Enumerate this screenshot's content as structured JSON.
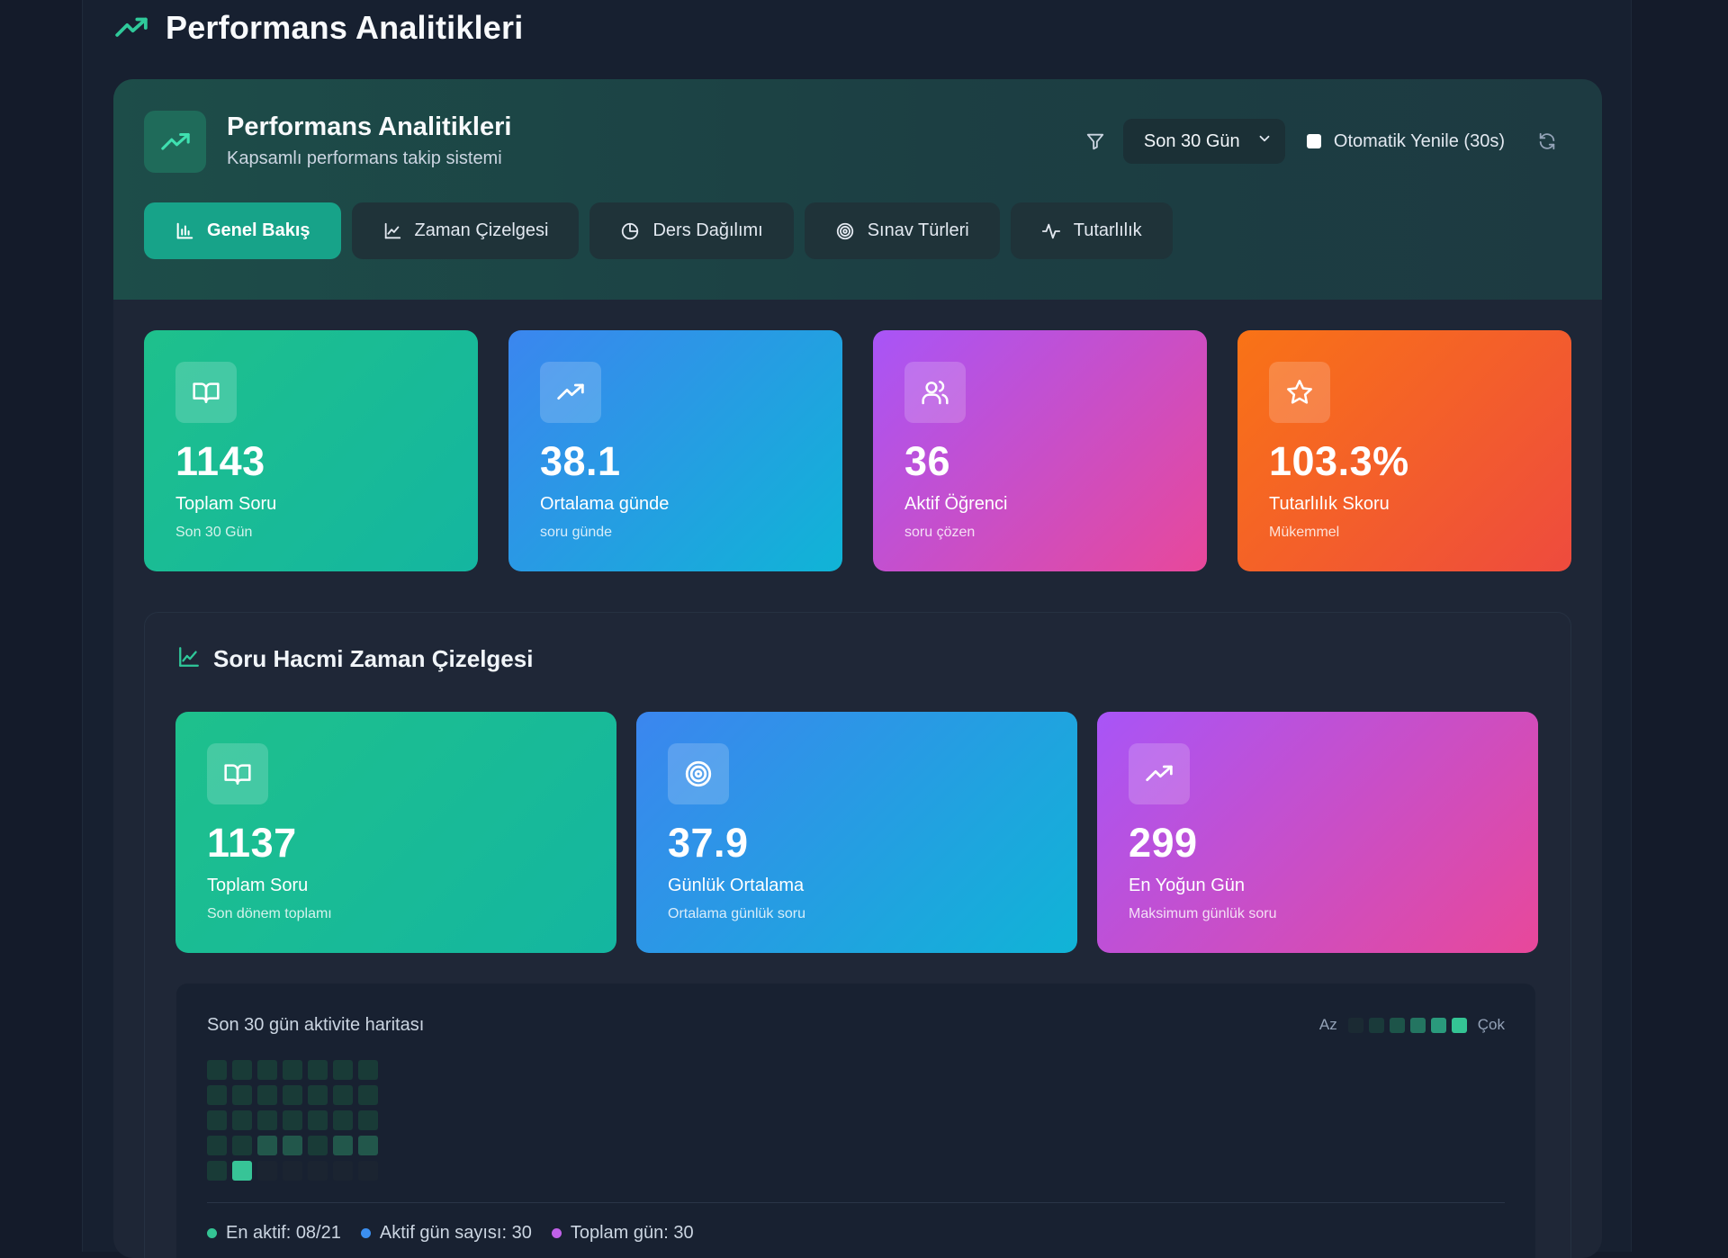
{
  "page": {
    "title": "Performans Analitikleri"
  },
  "header": {
    "title": "Performans Analitikleri",
    "subtitle": "Kapsamlı performans takip sistemi",
    "range_select": "Son 30 Gün",
    "auto_refresh_label": "Otomatik Yenile (30s)",
    "auto_refresh_checked": false
  },
  "tabs": [
    {
      "label": "Genel Bakış",
      "icon": "bar-chart-icon",
      "active": true
    },
    {
      "label": "Zaman Çizelgesi",
      "icon": "line-chart-icon",
      "active": false
    },
    {
      "label": "Ders Dağılımı",
      "icon": "pie-chart-icon",
      "active": false
    },
    {
      "label": "Sınav Türleri",
      "icon": "target-icon",
      "active": false
    },
    {
      "label": "Tutarlılık",
      "icon": "activity-icon",
      "active": false
    }
  ],
  "stats": [
    {
      "icon": "book-icon",
      "value": "1143",
      "label": "Toplam Soru",
      "sub": "Son 30 Gün"
    },
    {
      "icon": "trend-up-icon",
      "value": "38.1",
      "label": "Ortalama günde",
      "sub": "soru günde"
    },
    {
      "icon": "users-icon",
      "value": "36",
      "label": "Aktif Öğrenci",
      "sub": "soru çözen"
    },
    {
      "icon": "star-icon",
      "value": "103.3%",
      "label": "Tutarlılık Skoru",
      "sub": "Mükemmel"
    }
  ],
  "timeline": {
    "title": "Soru Hacmi Zaman Çizelgesi",
    "stats": [
      {
        "icon": "book-icon",
        "value": "1137",
        "label": "Toplam Soru",
        "sub": "Son dönem toplamı"
      },
      {
        "icon": "target-icon",
        "value": "37.9",
        "label": "Günlük Ortalama",
        "sub": "Ortalama günlük soru"
      },
      {
        "icon": "trend-up-icon",
        "value": "299",
        "label": "En Yoğun Gün",
        "sub": "Maksimum günlük soru"
      }
    ]
  },
  "heatmap": {
    "title": "Son 30 gün aktivite haritası",
    "legend_low": "Az",
    "legend_high": "Çok",
    "legend_colors": [
      "#1b2a33",
      "#1a3a3a",
      "#1d5449",
      "#247561",
      "#2a9a7c",
      "#34c494"
    ],
    "levels": [
      1,
      1,
      1,
      1,
      1,
      1,
      1,
      1,
      1,
      1,
      1,
      1,
      1,
      1,
      1,
      1,
      1,
      1,
      1,
      1,
      1,
      1,
      1,
      2,
      2,
      1,
      2,
      2,
      1,
      5,
      0,
      0,
      0,
      0,
      0
    ],
    "level_colors": [
      "#1b2431",
      "#193b37",
      "#22574b",
      "#247561",
      "#2a9a7c",
      "#37c497"
    ],
    "footer": [
      {
        "text": "En aktif: 08/21",
        "color": "#34c494"
      },
      {
        "text": "Aktif gün sayısı: 30",
        "color": "#3b8ff0"
      },
      {
        "text": "Toplam gün: 30",
        "color": "#c061e8"
      }
    ]
  }
}
